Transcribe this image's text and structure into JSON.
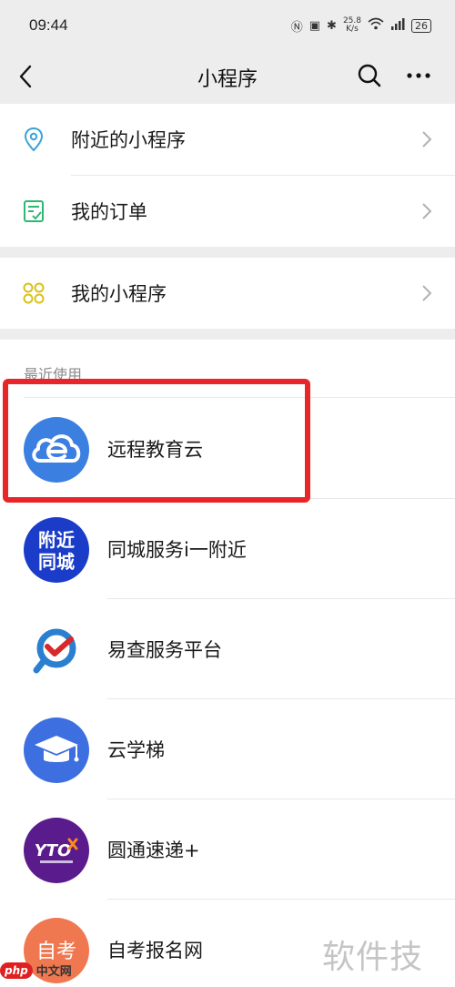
{
  "status_bar": {
    "time": "09:44",
    "network_speed_value": "25.8",
    "network_speed_unit": "K/s",
    "battery": "26"
  },
  "nav": {
    "title": "小程序"
  },
  "menu": {
    "nearby": "附近的小程序",
    "orders": "我的订单",
    "my_miniprograms": "我的小程序"
  },
  "recent": {
    "header": "最近使用",
    "apps": [
      {
        "name": "远程教育云",
        "icon": "cloud-e-icon",
        "color": "#3b7fe0"
      },
      {
        "name": "同城服务i一附近",
        "icon": "nearby-city-icon",
        "color": "#1a3cc8"
      },
      {
        "name": "易查服务平台",
        "icon": "check-search-icon",
        "color": "#2a7fd0"
      },
      {
        "name": "云学梯",
        "icon": "graduation-cap-icon",
        "color": "#3d6fe0"
      },
      {
        "name": "圆通速递+",
        "icon": "yto-logo-icon",
        "color": "#5a1b8c"
      },
      {
        "name": "自考报名网",
        "icon": "self-exam-icon",
        "color": "#f07850"
      }
    ],
    "icon_texts": {
      "nearby_top": "附近",
      "nearby_bottom": "同城",
      "yto": "YTO",
      "self_exam": "自考"
    }
  },
  "highlight_color": "#e8262a",
  "watermark": {
    "site_logo": "php",
    "site_name": "中文网",
    "caption": "软件技巧"
  }
}
